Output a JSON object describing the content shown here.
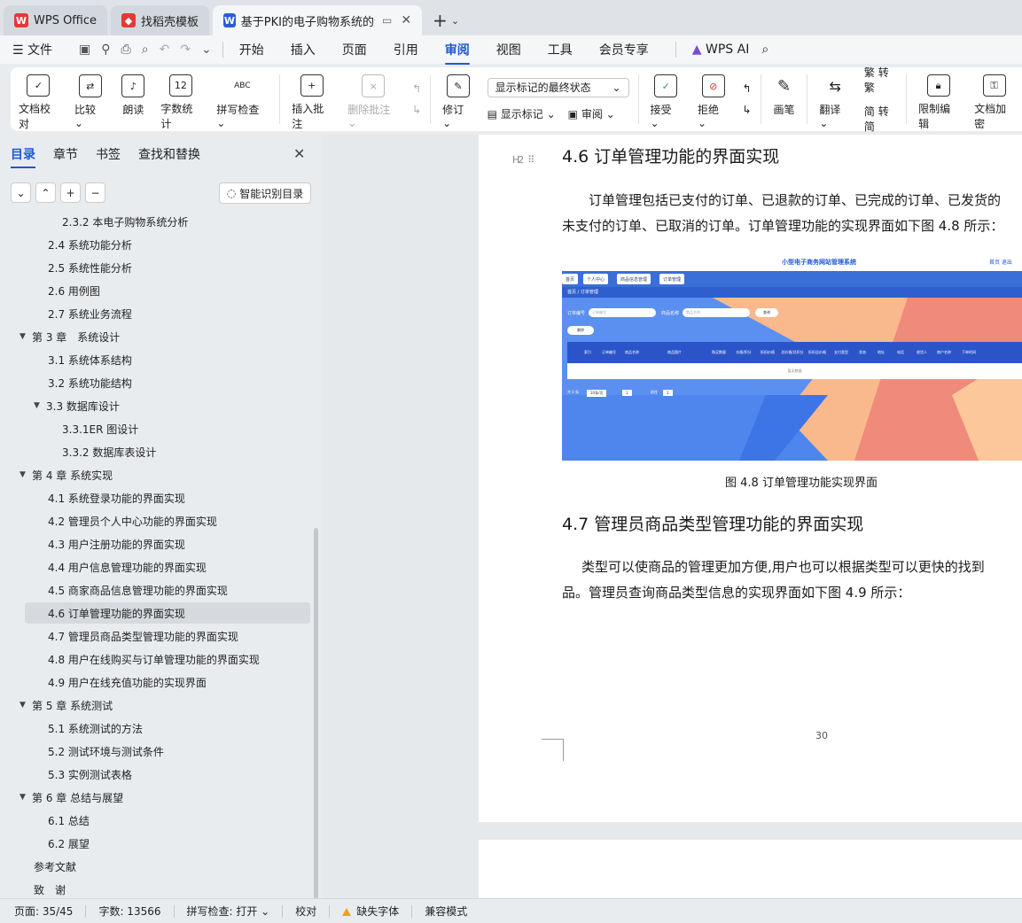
{
  "tabs": [
    {
      "label": "WPS Office",
      "icon": "wps-logo-icon",
      "color": "#e53935"
    },
    {
      "label": "找稻壳模板",
      "icon": "docer-icon",
      "color": "#e53935"
    },
    {
      "label": "基于PKI的电子购物系统的设计",
      "icon": "word-doc-icon",
      "color": "#2b5bd7"
    }
  ],
  "menu": {
    "file": "文件",
    "items": [
      "开始",
      "插入",
      "页面",
      "引用",
      "审阅",
      "视图",
      "工具",
      "会员专享"
    ],
    "active": "审阅",
    "wps_ai": "WPS AI"
  },
  "ribbon": {
    "doc_check": "文档校对",
    "compare": "比较",
    "read_aloud": "朗读",
    "word_count": "字数统计",
    "spell_check": "拼写检查",
    "insert_comment": "插入批注",
    "delete_comment": "删除批注",
    "track": "修订",
    "markup_select": "显示标记的最终状态",
    "show_markup": "显示标记",
    "review": "审阅",
    "accept": "接受",
    "reject": "拒绝",
    "pen": "画笔",
    "translate": "翻译",
    "to_traditional": "转繁",
    "to_simplified": "转简",
    "restrict_edit": "限制编辑",
    "doc_encrypt": "文档加密",
    "icon_word_count": "12",
    "icon_spell": "ABC"
  },
  "sidebar": {
    "tabs": [
      "目录",
      "章节",
      "书签",
      "查找和替换"
    ],
    "active_tab": "目录",
    "ai_toc": "智能识别目录",
    "toc": [
      {
        "label": "2.3.2 本电子购物系统分析",
        "level": 3
      },
      {
        "label": "2.4 系统功能分析",
        "level": 2
      },
      {
        "label": "2.5 系统性能分析",
        "level": 2
      },
      {
        "label": "2.6 用例图",
        "level": 2
      },
      {
        "label": "2.7 系统业务流程",
        "level": 2
      },
      {
        "label": "第 3 章　系统设计",
        "level": 1
      },
      {
        "label": "3.1 系统体系结构",
        "level": 2
      },
      {
        "label": "3.2 系统功能结构",
        "level": 2
      },
      {
        "label": "3.3 数据库设计",
        "level": 2
      },
      {
        "label": "3.3.1ER 图设计",
        "level": 3
      },
      {
        "label": "3.3.2 数据库表设计",
        "level": 3
      },
      {
        "label": "第 4 章  系统实现",
        "level": 1
      },
      {
        "label": "4.1 系统登录功能的界面实现",
        "level": 2
      },
      {
        "label": "4.2 管理员个人中心功能的界面实现",
        "level": 2
      },
      {
        "label": "4.3 用户注册功能的界面实现",
        "level": 2
      },
      {
        "label": "4.4 用户信息管理功能的界面实现",
        "level": 2
      },
      {
        "label": "4.5 商家商品信息管理功能的界面实现",
        "level": 2
      },
      {
        "label": "4.6 订单管理功能的界面实现",
        "level": 2
      },
      {
        "label": "4.7 管理员商品类型管理功能的界面实现",
        "level": 2
      },
      {
        "label": "4.8 用户在线购买与订单管理功能的界面实现",
        "level": 2
      },
      {
        "label": "4.9 用户在线充值功能的实现界面",
        "level": 2
      },
      {
        "label": "第 5 章  系统测试",
        "level": 1
      },
      {
        "label": "5.1 系统测试的方法",
        "level": 2
      },
      {
        "label": "5.2 测试环境与测试条件",
        "level": 2
      },
      {
        "label": "5.3 实例测试表格",
        "level": 2
      },
      {
        "label": "第 6 章  总结与展望",
        "level": 1
      },
      {
        "label": "6.1  总结",
        "level": 2
      },
      {
        "label": "6.2  展望",
        "level": 2
      },
      {
        "label": "参考文献",
        "level": 0
      },
      {
        "label": "致　谢",
        "level": 0
      }
    ],
    "selected": "4.6 订单管理功能的界面实现"
  },
  "document": {
    "heading_1": "4.6 订单管理功能的界面实现",
    "para_1_line_1": "订单管理包括已支付的订单、已退款的订单、已完成的订单、已发货的",
    "para_1_line_2": "未支付的订单、已取消的订单。订单管理功能的实现界面如下图 4.8 所示：",
    "figure_caption": "图 4.8 订单管理功能实现界面",
    "heading_2": "4.7 管理员商品类型管理功能的界面实现",
    "para_2_line_1": "类型可以使商品的管理更加方便,用户也可以根据类型可以更快的找到",
    "para_2_line_2": "品。管理员查询商品类型信息的实现界面如下图 4.9 所示：",
    "page_number": "30",
    "heading_marker": "H2",
    "figure": {
      "title": "小型电子商务网站管理系统",
      "top_right": "首页  退出",
      "nav_tabs": [
        "首页",
        "个人中心",
        "商品信息管理",
        "订单管理"
      ],
      "breadcrumb": "首页 / 订单管理",
      "search_label_1": "订单编号",
      "search_placeholder_1": "订单编号",
      "search_label_2": "商品名称",
      "search_placeholder_2": "商品名称",
      "search_btn": "查询",
      "delete_btn": "删除",
      "columns": [
        "索引",
        "订单编号",
        "商品名称",
        "商品图片",
        "购买数量",
        "价格/积分",
        "折扣价格",
        "总价格/总积分",
        "折扣总价格",
        "支付类型",
        "状态",
        "地址",
        "电话",
        "收货人",
        "商户名称",
        "下单时间"
      ],
      "empty_text": "暂无数据",
      "pager": [
        "共 0 条",
        "10条/页",
        "1",
        "前往",
        "1"
      ]
    }
  },
  "status": {
    "page": "页面: 35/45",
    "words": "字数: 13566",
    "spell": "拼写检查: 打开",
    "proof": "校对",
    "missing_font": "缺失字体",
    "compat": "兼容模式"
  }
}
